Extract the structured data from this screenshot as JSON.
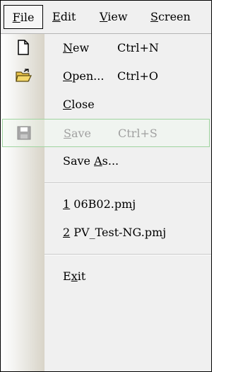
{
  "menubar": {
    "file": {
      "pre": "",
      "mn": "F",
      "post": "ile"
    },
    "edit": {
      "pre": "",
      "mn": "E",
      "post": "dit"
    },
    "view": {
      "pre": "",
      "mn": "V",
      "post": "iew"
    },
    "screen": {
      "pre": "",
      "mn": "S",
      "post": "creen"
    }
  },
  "file_menu": {
    "new": {
      "pre": "",
      "mn": "N",
      "post": "ew",
      "shortcut": "Ctrl+N",
      "icon": "new-document-icon"
    },
    "open": {
      "pre": "",
      "mn": "O",
      "post": "pen...",
      "shortcut": "Ctrl+O",
      "icon": "open-folder-icon"
    },
    "close": {
      "pre": "",
      "mn": "C",
      "post": "lose"
    },
    "save": {
      "pre": "",
      "mn": "S",
      "post": "ave",
      "shortcut": "Ctrl+S",
      "icon": "save-disk-icon",
      "enabled": false
    },
    "save_as": {
      "pre": "Save ",
      "mn": "A",
      "post": "s..."
    },
    "recent": [
      {
        "pre": "",
        "mn": "1",
        "post": " 06B02.pmj"
      },
      {
        "pre": "",
        "mn": "2",
        "post": " PV_Test-NG.pmj"
      }
    ],
    "exit": {
      "pre": "E",
      "mn": "x",
      "post": "it"
    }
  },
  "colors": {
    "menu_bg": "#f0f0f0",
    "disabled_text": "#a0a0a0",
    "hover_border": "#9fd49f",
    "separator": "#c8c8c8"
  }
}
